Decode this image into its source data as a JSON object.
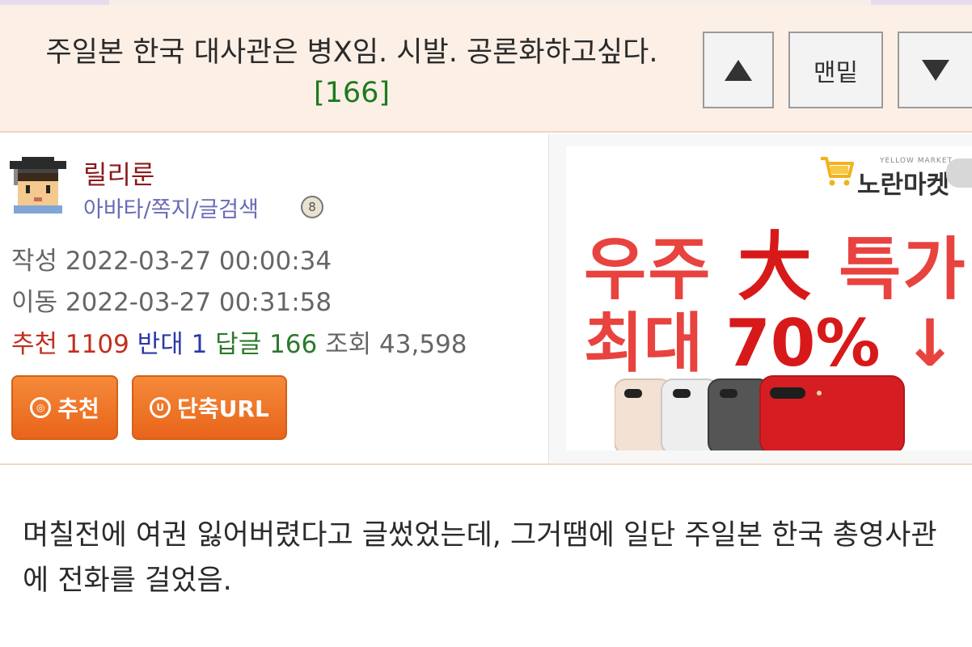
{
  "post": {
    "title": "주일본 한국 대사관은 병X임. 시발. 공론화하고싶다.",
    "reply_count_label": "[166]"
  },
  "nav": {
    "up_label": "",
    "bottom_label": "맨밑",
    "down_label": ""
  },
  "author": {
    "name": "릴리룬",
    "links": "아바타/쪽지/글검색",
    "badge": "8"
  },
  "meta": {
    "created": "작성 2022-03-27 00:00:34",
    "moved": "이동 2022-03-27 00:31:58"
  },
  "stats": {
    "recommend_label": "추천",
    "recommend_value": "1109",
    "oppose_label": "반대",
    "oppose_value": "1",
    "replies_label": "답글",
    "replies_value": "166",
    "views_label": "조회",
    "views_value": "43,598"
  },
  "actions": {
    "recommend_icon_text": "◎",
    "recommend_label": "추천",
    "short_url_icon_text": "U",
    "short_url_label": "단축URL"
  },
  "ad": {
    "brand_en": "YELLOW MARKET",
    "brand": "노란마켓",
    "headline_a": "우주",
    "headline_big": "大",
    "headline_b": "특가",
    "subline_a": "최대",
    "subline_pct": "70%",
    "subline_arrow": "↓"
  },
  "body": {
    "text": "며칠전에 여권 잃어버렸다고 글썼었는데, 그거땜에 일단 주일본 한국 총영사관에 전화를 걸었음."
  },
  "colors": {
    "title_bg": "#fcefe6",
    "username": "#8b1a1a",
    "links": "#6a6ab8",
    "recommend": "#c0301e",
    "oppose": "#2a3aa8",
    "replies": "#2c7a2c",
    "button_orange": "#ee7326",
    "ad_red": "#e8433f"
  },
  "icons": {
    "up": "triangle-up-icon",
    "down": "triangle-down-icon",
    "avatar": "graduate-avatar-icon",
    "cart": "cart-icon"
  }
}
